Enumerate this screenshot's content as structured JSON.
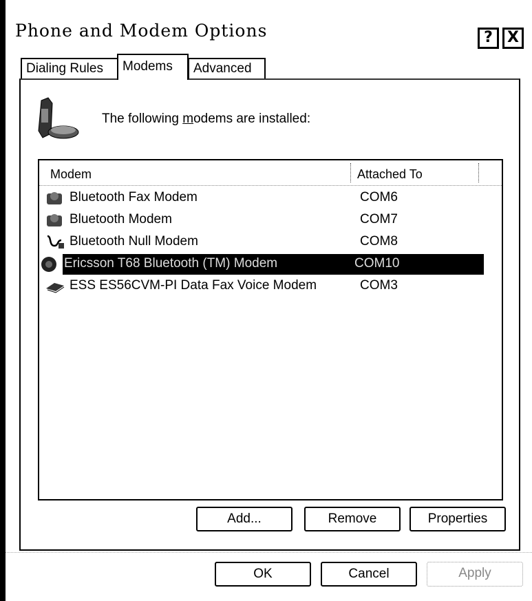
{
  "window": {
    "title": "Phone and Modem Options",
    "help_label": "?",
    "close_label": "X"
  },
  "tabs": [
    {
      "label": "Dialing Rules",
      "active": false
    },
    {
      "label": "Modems",
      "active": true
    },
    {
      "label": "Advanced",
      "active": false
    }
  ],
  "info": {
    "text_before": "The following ",
    "text_underlined": "m",
    "text_after": "odems are  installed:"
  },
  "list": {
    "headers": {
      "modem": "Modem",
      "attached_to": "Attached To"
    },
    "rows": [
      {
        "name": "Bluetooth Fax Modem",
        "port": "COM6",
        "icon": "fax-modem-icon",
        "selected": false
      },
      {
        "name": "Bluetooth Modem",
        "port": "COM7",
        "icon": "modem-icon",
        "selected": false
      },
      {
        "name": "Bluetooth Null Modem",
        "port": "COM8",
        "icon": "null-modem-cable-icon",
        "selected": false
      },
      {
        "name": "Ericsson T68 Bluetooth (TM) Modem",
        "port": "COM10",
        "icon": "phone-modem-icon",
        "selected": true
      },
      {
        "name": "ESS ES56CVM-PI Data Fax Voice Modem",
        "port": "COM3",
        "icon": "pci-modem-icon",
        "selected": false
      }
    ]
  },
  "buttons": {
    "add": "Add...",
    "remove": "Remove",
    "properties": "Properties",
    "ok": "OK",
    "cancel": "Cancel",
    "apply": "Apply"
  }
}
